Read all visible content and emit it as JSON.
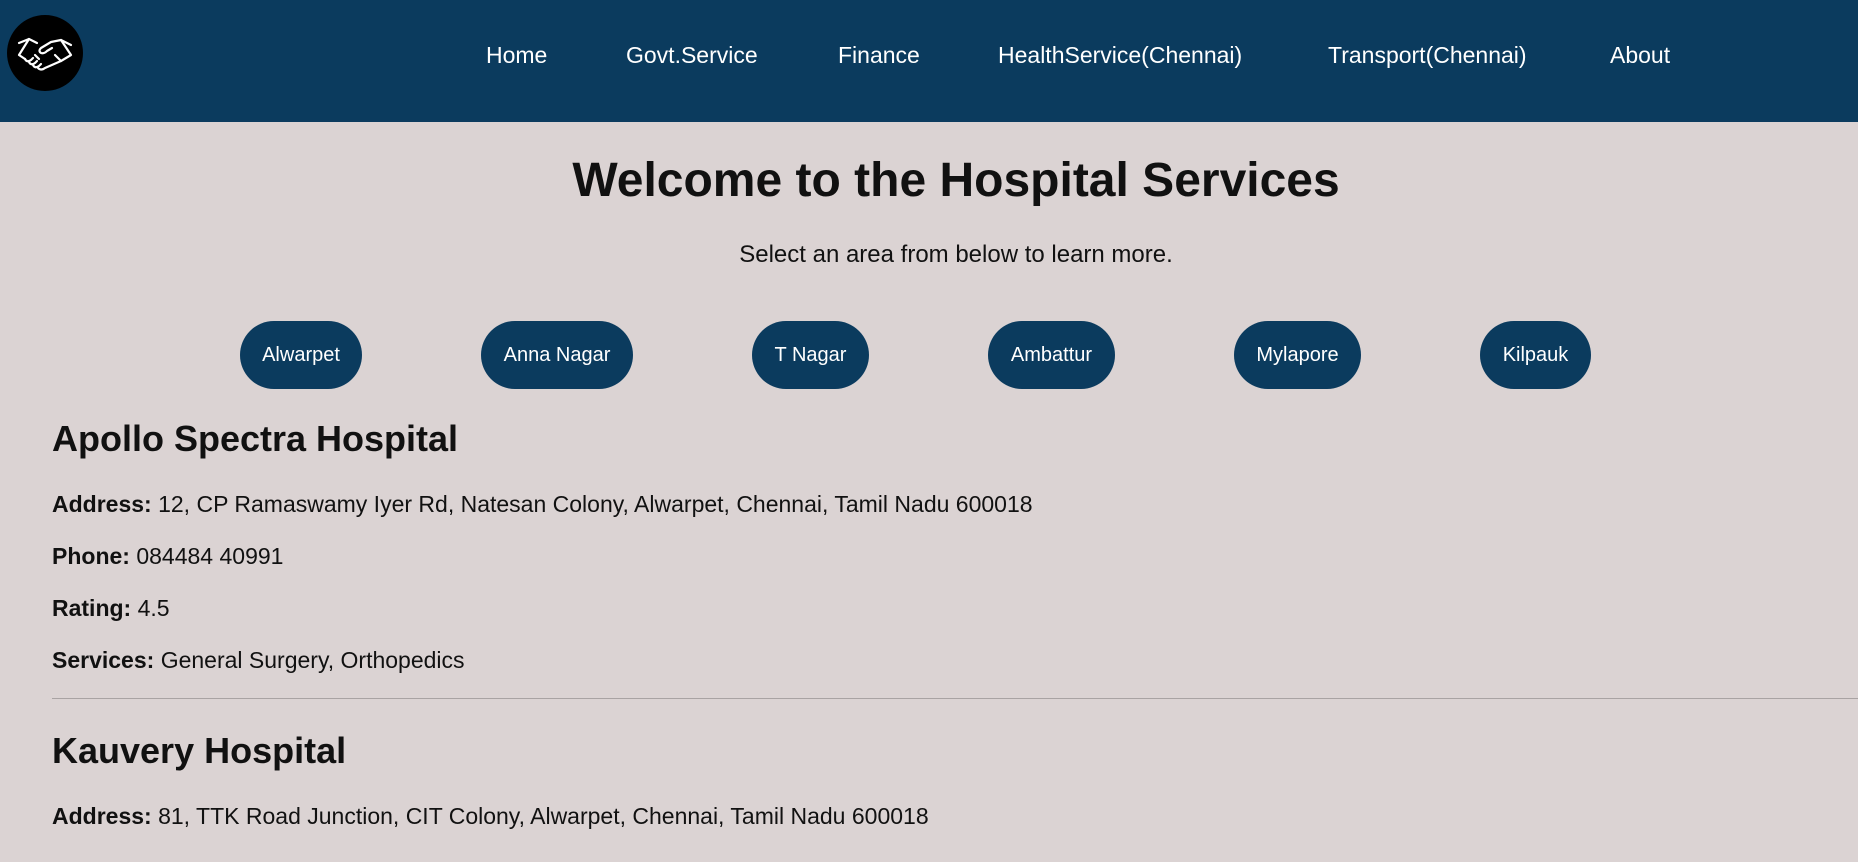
{
  "header": {
    "logo_icon": "handshake-icon",
    "nav": [
      "Home",
      "Govt.Service",
      "Finance",
      "HealthService(Chennai)",
      "Transport(Chennai)",
      "About"
    ]
  },
  "main": {
    "title": "Welcome to the Hospital Services",
    "subtitle": "Select an area from below to learn more.",
    "areas": [
      "Alwarpet",
      "Anna Nagar",
      "T Nagar",
      "Ambattur",
      "Mylapore",
      "Kilpauk"
    ]
  },
  "labels": {
    "address": "Address:",
    "phone": "Phone:",
    "rating": "Rating:",
    "services": "Services:"
  },
  "hospitals": [
    {
      "name": "Apollo Spectra Hospital",
      "address": "12, CP Ramaswamy Iyer Rd, Natesan Colony, Alwarpet, Chennai, Tamil Nadu 600018",
      "phone": "084484 40991",
      "rating": "4.5",
      "services": "General Surgery, Orthopedics"
    },
    {
      "name": "Kauvery Hospital",
      "address": "81, TTK Road Junction, CIT Colony, Alwarpet, Chennai, Tamil Nadu 600018"
    }
  ],
  "colors": {
    "header_bg": "#0b3b5e",
    "page_bg": "#dbd3d3",
    "button_bg": "#0b3b5e",
    "text": "#111111"
  }
}
